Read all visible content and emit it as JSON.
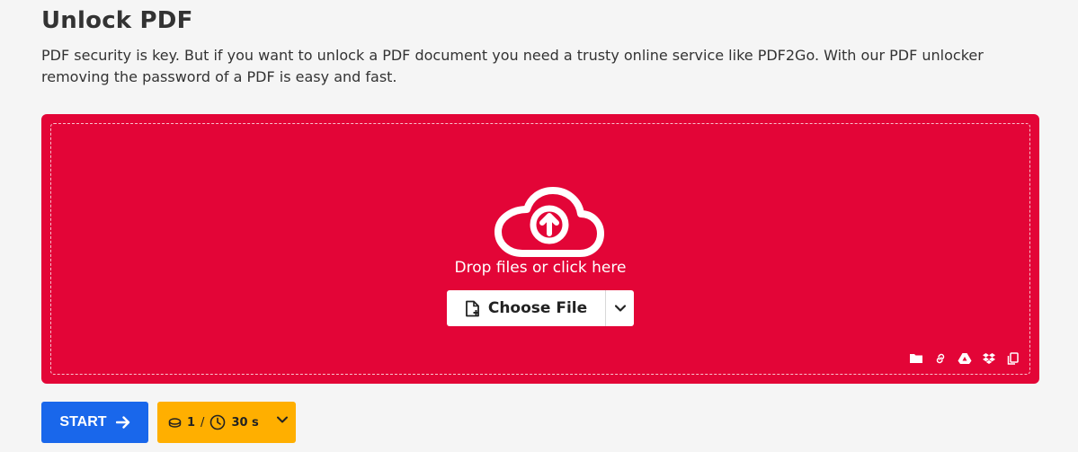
{
  "page": {
    "title": "Unlock PDF",
    "description": "PDF security is key. But if you want to unlock a PDF document you need a trusty online service like PDF2Go. With our PDF unlocker removing the password of a PDF is easy and fast."
  },
  "dropzone": {
    "background_color": "#e30537",
    "prompt": "Drop files or click here",
    "choose_file_label": "Choose File",
    "source_icons": [
      "folder-icon",
      "link-icon",
      "google-drive-icon",
      "dropbox-icon",
      "clipboard-icon"
    ]
  },
  "actions": {
    "start_label": "START",
    "start_color": "#1967eb",
    "credits_value": "1",
    "credits_separator": "/",
    "time_value": "30 s",
    "credits_color": "#ffaf00"
  }
}
